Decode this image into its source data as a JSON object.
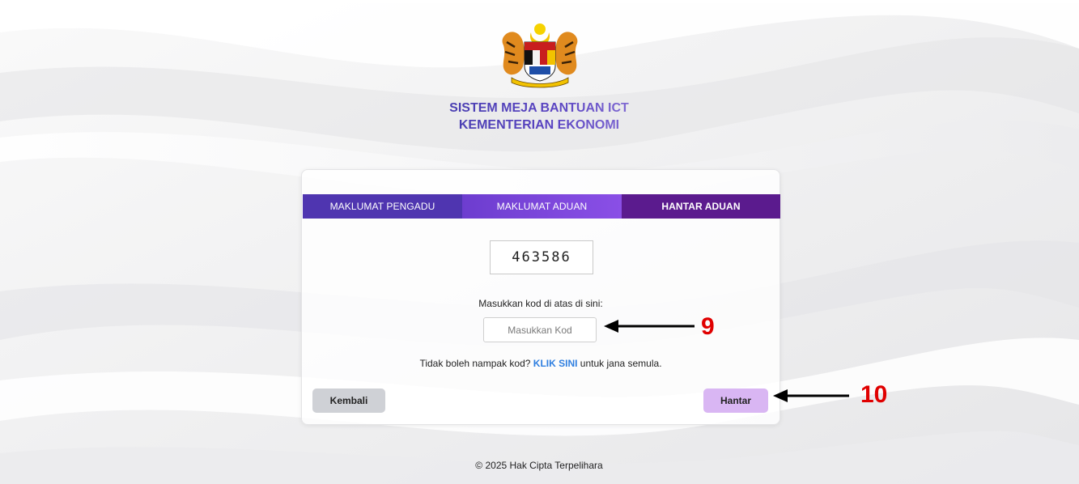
{
  "site": {
    "title_line1": "SISTEM MEJA BANTUAN ICT",
    "title_line2": "KEMENTERIAN EKONOMI"
  },
  "crest": {
    "icon": "malaysia-coat-of-arms-icon"
  },
  "steps": [
    {
      "label": "MAKLUMAT PENGADU",
      "state": "done"
    },
    {
      "label": "MAKLUMAT ADUAN",
      "state": "done"
    },
    {
      "label": "HANTAR ADUAN",
      "state": "active"
    }
  ],
  "captcha": {
    "code": "463586",
    "label": "Masukkan kod di atas di sini:",
    "input_value": "",
    "input_placeholder": "Masukkan Kod"
  },
  "help": {
    "before": "Tidak boleh nampak kod?",
    "link_text": "KLIK SINI",
    "after": "untuk jana semula."
  },
  "buttons": {
    "back_label": "Kembali",
    "submit_label": "Hantar"
  },
  "footer": {
    "copyright": "© 2025 Hak Cipta Terpelihara"
  },
  "annotations": [
    {
      "number": "9",
      "color": "#e00000"
    },
    {
      "number": "10",
      "color": "#e00000"
    }
  ],
  "colors": {
    "step_1": "#4f35b0",
    "step_2": "#7a45da",
    "step_3_active": "#5b1b8e",
    "link": "#2f7fe0",
    "submit_button": "#d9b6f3",
    "back_button": "#cfd1d6",
    "annotation": "#e00000"
  }
}
